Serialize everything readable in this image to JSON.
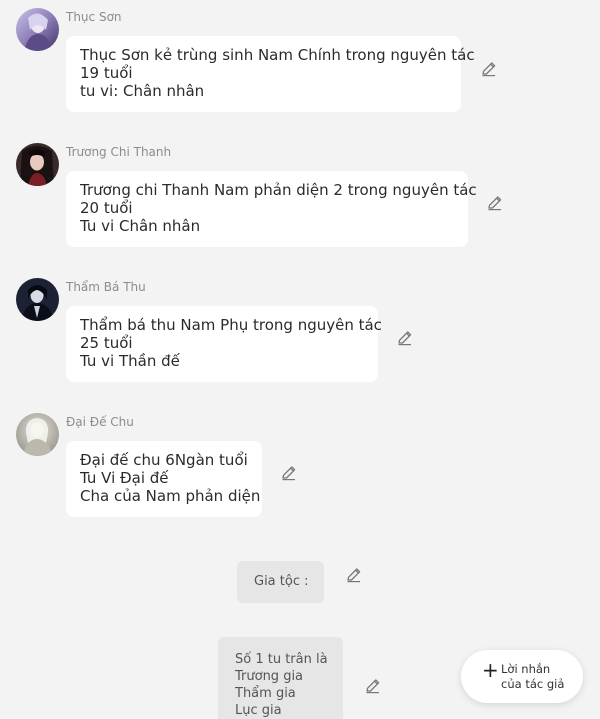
{
  "messages": [
    {
      "sender": "Thục Sơn",
      "lines": [
        "Thục Sơn kẻ trùng sinh Nam Chính trong nguyên tác",
        "19 tuổi",
        "tu vi: Chân nhân"
      ],
      "avatar_icon": "avatar-thuc-son"
    },
    {
      "sender": "Trương Chi Thanh",
      "lines": [
        "Trương chi Thanh Nam phản diện 2 trong nguyên tác",
        "20 tuổi",
        "Tu vi Chân nhân"
      ],
      "avatar_icon": "avatar-truong-chi-thanh"
    },
    {
      "sender": "Thẩm Bá Thu",
      "lines": [
        "Thẩm bá thu Nam Phụ trong nguyên tác",
        "25 tuổi",
        "Tu vi Thần đế"
      ],
      "avatar_icon": "avatar-tham-ba-thu"
    },
    {
      "sender": "Đại Đế Chu",
      "lines": [
        "Đại đế chu 6Ngàn tuổi",
        "Tu Vi Đại đế",
        "Cha của Nam phản diện"
      ],
      "avatar_icon": "avatar-dai-de-chu"
    }
  ],
  "narration": [
    {
      "lines": [
        "Gia tộc :"
      ]
    },
    {
      "lines": [
        "Số 1 tu trân là",
        "Trương gia",
        "Thẩm gia",
        "Lục gia"
      ]
    }
  ],
  "fab": {
    "icon": "plus-icon",
    "line1": "Lời nhắn",
    "line2": "của tác giả"
  },
  "colors": {
    "background": "#f3f3f3",
    "bubble": "#ffffff",
    "narration_bubble": "#e6e6e6",
    "sender_text": "#8c8c8c"
  }
}
